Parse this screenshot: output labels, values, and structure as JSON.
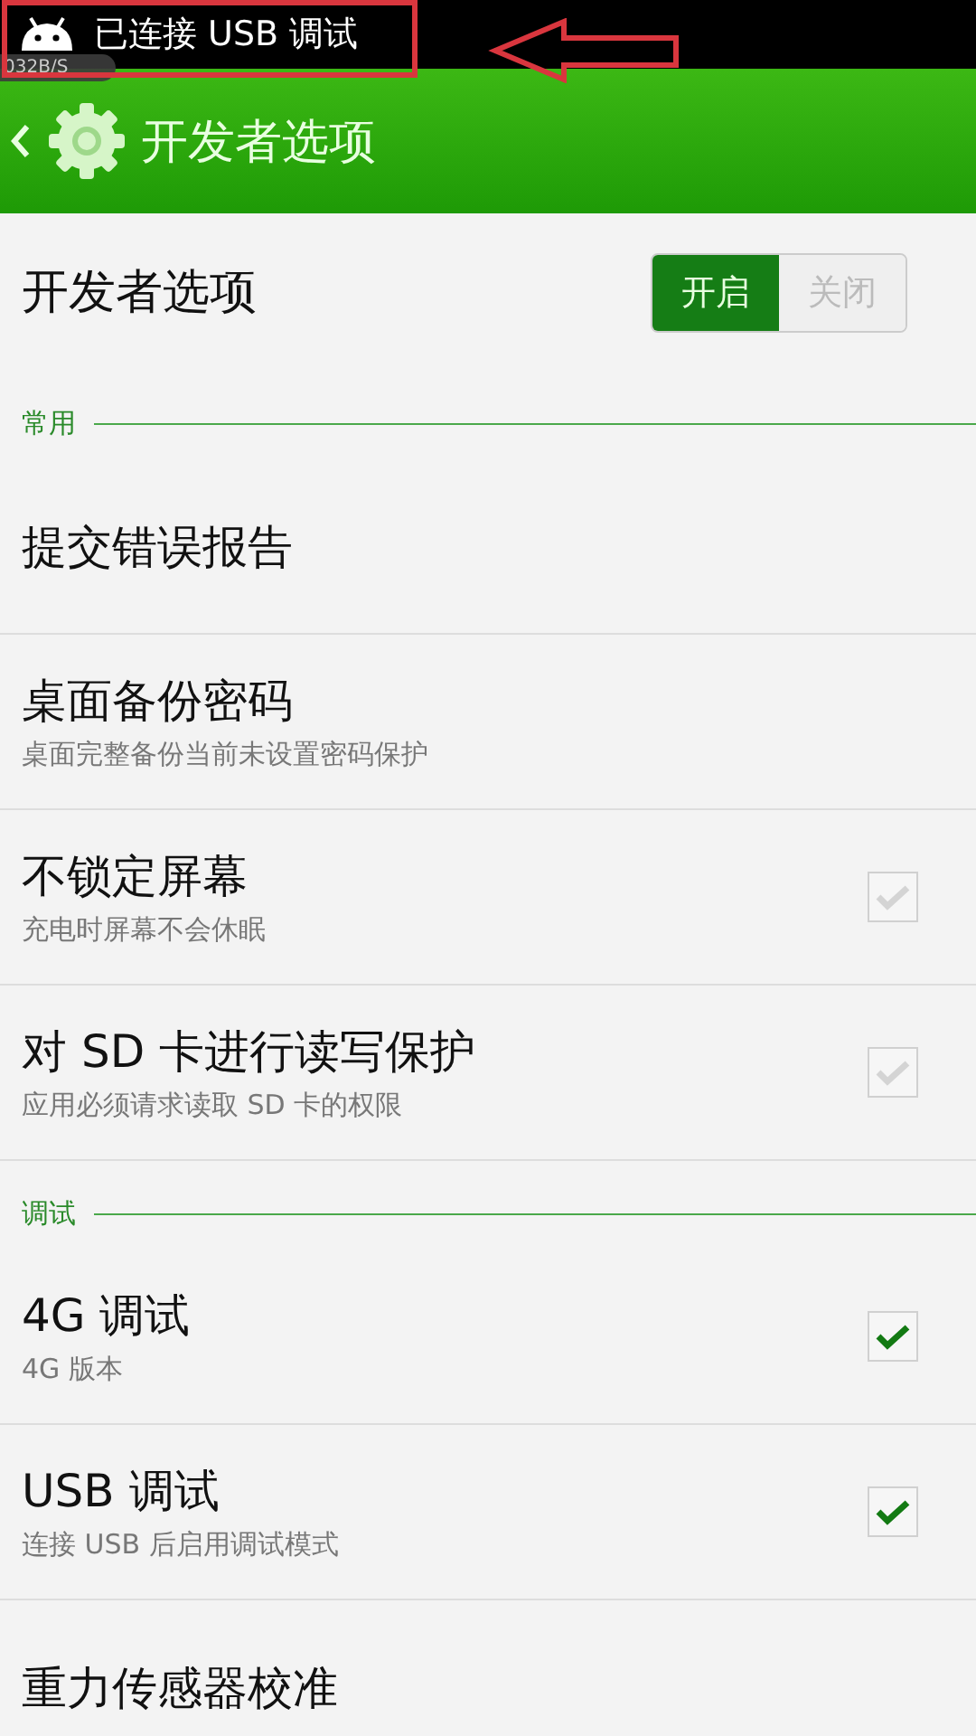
{
  "status_bar": {
    "notification": "已连接 USB 调试",
    "traffic": "032B/S"
  },
  "header": {
    "title": "开发者选项"
  },
  "master": {
    "label": "开发者选项",
    "options": [
      {
        "label": "开启",
        "selected": true
      },
      {
        "label": "关闭",
        "selected": false
      }
    ]
  },
  "sections": [
    {
      "title": "常用",
      "items": [
        {
          "kind": "link",
          "title": "提交错误报告"
        },
        {
          "kind": "link",
          "title": "桌面备份密码",
          "subtitle": "桌面完整备份当前未设置密码保护"
        },
        {
          "kind": "checkbox",
          "title": "不锁定屏幕",
          "subtitle": "充电时屏幕不会休眠",
          "checked": false
        },
        {
          "kind": "checkbox",
          "title": "对 SD 卡进行读写保护",
          "subtitle": "应用必须请求读取 SD 卡的权限",
          "checked": false
        }
      ]
    },
    {
      "title": "调试",
      "items": [
        {
          "kind": "checkbox",
          "title": "4G 调试",
          "subtitle": "4G 版本",
          "checked": true
        },
        {
          "kind": "checkbox",
          "title": "USB 调试",
          "subtitle": "连接 USB 后启用调试模式",
          "checked": true
        },
        {
          "kind": "link",
          "title": "重力传感器校准"
        }
      ]
    }
  ]
}
